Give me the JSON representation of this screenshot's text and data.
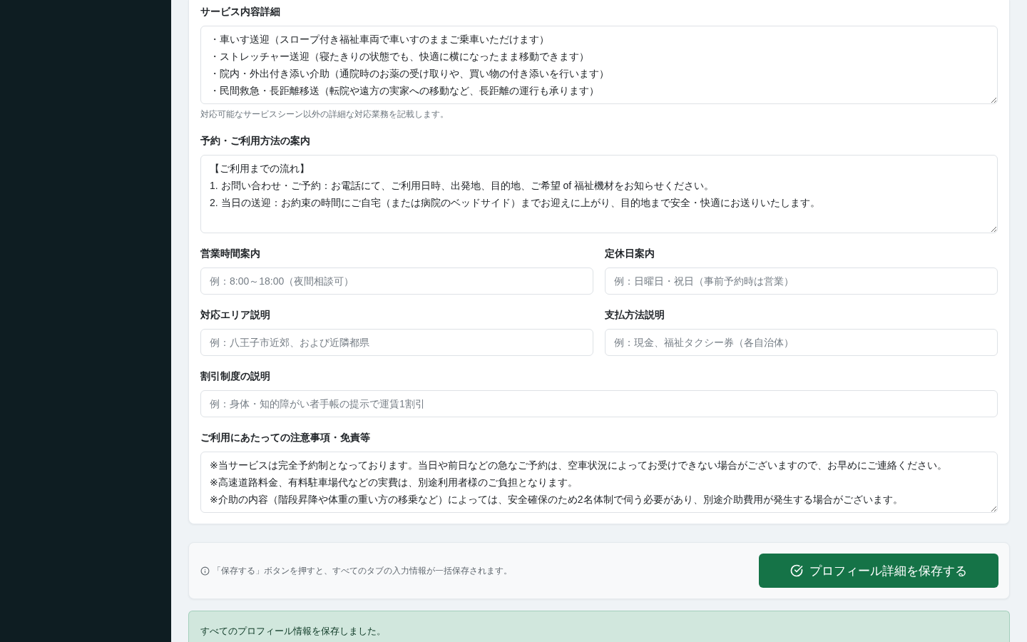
{
  "form": {
    "sections": [
      {
        "kind": "textarea",
        "label": "サービス内容詳細",
        "lines": [
          "・車いす送迎（スロープ付き福祉車両で車いすのままご乗車いただけます）",
          "・ストレッチャー送迎（寝たきりの状態でも、快適に横になったまま移動できます）",
          "・院内・外出付き添い介助（通院時のお薬の受け取りや、買い物の付き添いを行います）",
          "・民間救急・長距離移送（転院や遠方の実家への移動など、長距離の運行も承ります）"
        ],
        "help": "対応可能なサービスシーン以外の詳細な対応業務を記載します。"
      },
      {
        "kind": "textarea",
        "label": "予約・ご利用方法の案内",
        "lines": [
          "【ご利用までの流れ】",
          "1. お問い合わせ・ご予約：お電話にて、ご利用日時、出発地、目的地、ご希望 of 福祉機材をお知らせください。",
          "2. 当日の送迎：お約束の時間にご自宅（または病院のベッドサイド）までお迎えに上がり、目的地まで安全・快適にお送りいたします。"
        ]
      },
      {
        "kind": "pair",
        "fields": [
          {
            "label": "営業時間案内",
            "placeholder": "例：8:00～18:00（夜間相談可）"
          },
          {
            "label": "定休日案内",
            "placeholder": "例：日曜日・祝日（事前予約時は営業）"
          }
        ]
      },
      {
        "kind": "pair",
        "fields": [
          {
            "label": "対応エリア説明",
            "placeholder": "例：八王子市近郊、および近隣都県"
          },
          {
            "label": "支払方法説明",
            "placeholder": "例：現金、福祉タクシー券（各自治体）"
          }
        ]
      },
      {
        "kind": "input",
        "label": "割引制度の説明",
        "placeholder": "例：身体・知的障がい者手帳の提示で運賃1割引"
      },
      {
        "kind": "textarea",
        "label": "ご利用にあたっての注意事項・免責等",
        "lines": [
          "※当サービスは完全予約制となっております。当日や前日などの急なご予約は、空車状況によってお受けできない場合がございますので、お早めにご連絡ください。",
          "※高速道路料金、有料駐車場代などの実費は、別途利用者様のご負担となります。",
          "※介助の内容（階段昇降や体重の重い方の移乗など）によっては、安全確保のため2名体制で伺う必要があり、別途介助費用が発生する場合がございます。"
        ]
      }
    ]
  },
  "save_bar": {
    "note": "「保存する」ボタンを押すと、すべてのタブの入力情報が一括保存されます。",
    "button": "プロフィール詳細を保存する"
  },
  "alert": {
    "message": "すべてのプロフィール情報を保存しました。"
  }
}
